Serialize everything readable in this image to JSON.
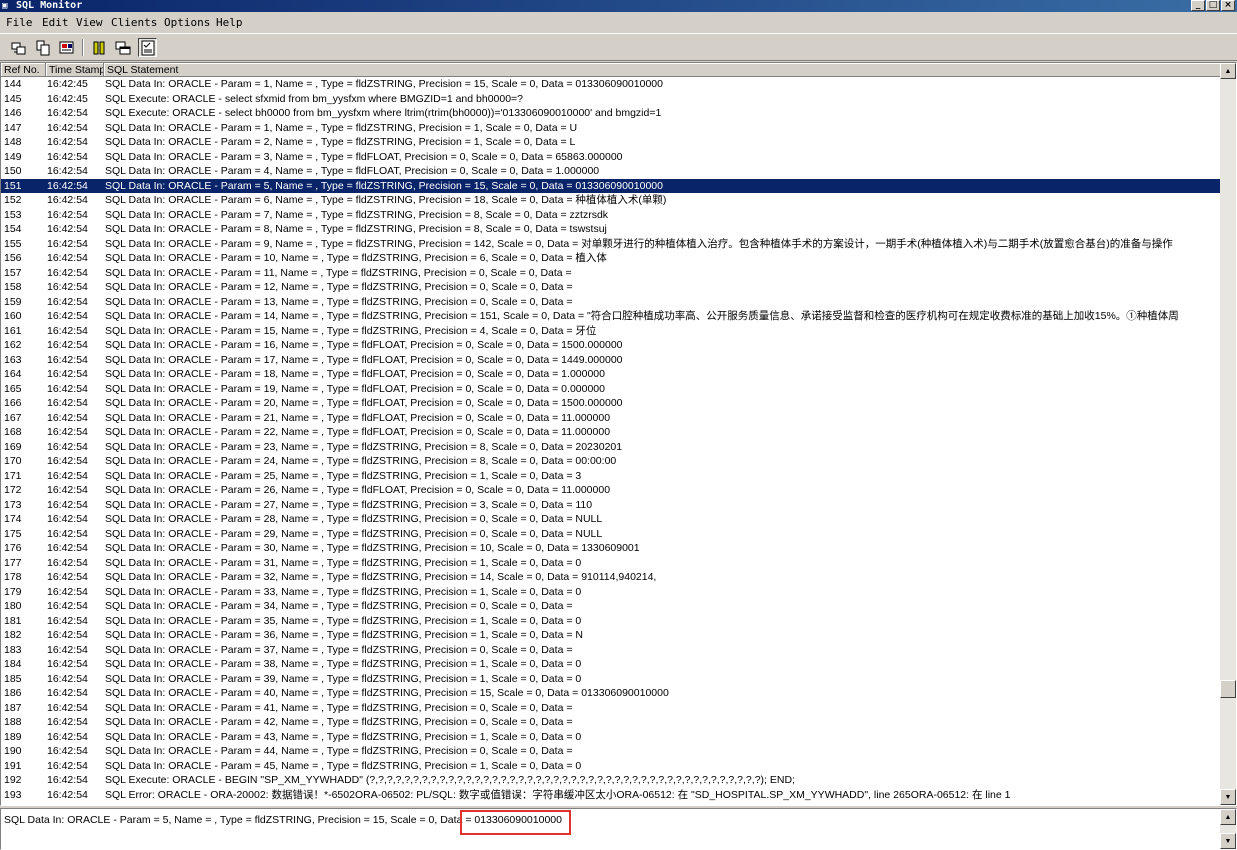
{
  "window": {
    "title": "SQL Monitor",
    "buttons": [
      "_",
      "□",
      "×"
    ]
  },
  "menu": [
    "File",
    "Edit",
    "View",
    "Clients",
    "Options",
    "Help"
  ],
  "toolbar": {
    "icons": [
      "clear-icon",
      "copy-icon",
      "print-icon",
      "pause-icon",
      "windows-icon",
      "checklist-icon"
    ]
  },
  "columns": [
    "Ref No.",
    "Time Stamp",
    "SQL Statement"
  ],
  "rows": [
    {
      "ref": "144",
      "time": "16:42:45",
      "sql": "SQL Data In: ORACLE - Param = 1, Name = , Type = fldZSTRING, Precision = 15, Scale = 0, Data = 013306090010000"
    },
    {
      "ref": "145",
      "time": "16:42:45",
      "sql": "SQL Execute: ORACLE - select sfxmid from bm_yysfxm where BMGZID=1 and bh0000=?"
    },
    {
      "ref": "146",
      "time": "16:42:54",
      "sql": "SQL Execute: ORACLE - select bh0000 from bm_yysfxm where ltrim(rtrim(bh0000))='013306090010000' and bmgzid=1"
    },
    {
      "ref": "147",
      "time": "16:42:54",
      "sql": "SQL Data In: ORACLE - Param = 1, Name = , Type = fldZSTRING, Precision = 1, Scale = 0, Data = U"
    },
    {
      "ref": "148",
      "time": "16:42:54",
      "sql": "SQL Data In: ORACLE - Param = 2, Name = , Type = fldZSTRING, Precision = 1, Scale = 0, Data = L"
    },
    {
      "ref": "149",
      "time": "16:42:54",
      "sql": "SQL Data In: ORACLE - Param = 3, Name = , Type = fldFLOAT, Precision = 0, Scale = 0, Data = 65863.000000"
    },
    {
      "ref": "150",
      "time": "16:42:54",
      "sql": "SQL Data In: ORACLE - Param = 4, Name = , Type = fldFLOAT, Precision = 0, Scale = 0, Data = 1.000000"
    },
    {
      "ref": "151",
      "time": "16:42:54",
      "sql": "SQL Data In: ORACLE - Param = 5, Name = , Type = fldZSTRING, Precision = 15, Scale = 0, Data = 013306090010000",
      "selected": true
    },
    {
      "ref": "152",
      "time": "16:42:54",
      "sql": "SQL Data In: ORACLE - Param = 6, Name = , Type = fldZSTRING, Precision = 18, Scale = 0, Data = 种植体植入术(单颗)"
    },
    {
      "ref": "153",
      "time": "16:42:54",
      "sql": "SQL Data In: ORACLE - Param = 7, Name = , Type = fldZSTRING, Precision = 8, Scale = 0, Data = zztzrsdk"
    },
    {
      "ref": "154",
      "time": "16:42:54",
      "sql": "SQL Data In: ORACLE - Param = 8, Name = , Type = fldZSTRING, Precision = 8, Scale = 0, Data = tswstsuj"
    },
    {
      "ref": "155",
      "time": "16:42:54",
      "sql": "SQL Data In: ORACLE - Param = 9, Name = , Type = fldZSTRING, Precision = 142, Scale = 0, Data = 对单颗牙进行的种植体植入治疗。包含种植体手术的方案设计，一期手术(种植体植入术)与二期手术(放置愈合基台)的准备与操作"
    },
    {
      "ref": "156",
      "time": "16:42:54",
      "sql": "SQL Data In: ORACLE - Param = 10, Name = , Type = fldZSTRING, Precision = 6, Scale = 0, Data = 植入体"
    },
    {
      "ref": "157",
      "time": "16:42:54",
      "sql": "SQL Data In: ORACLE - Param = 11, Name = , Type = fldZSTRING, Precision = 0, Scale = 0, Data ="
    },
    {
      "ref": "158",
      "time": "16:42:54",
      "sql": "SQL Data In: ORACLE - Param = 12, Name = , Type = fldZSTRING, Precision = 0, Scale = 0, Data ="
    },
    {
      "ref": "159",
      "time": "16:42:54",
      "sql": "SQL Data In: ORACLE - Param = 13, Name = , Type = fldZSTRING, Precision = 0, Scale = 0, Data ="
    },
    {
      "ref": "160",
      "time": "16:42:54",
      "sql": "SQL Data In: ORACLE - Param = 14, Name = , Type = fldZSTRING, Precision = 151, Scale = 0, Data = \"符合口腔种植成功率高、公开服务质量信息、承诺接受监督和检查的医疗机构可在规定收费标准的基础上加收15%。①种植体周"
    },
    {
      "ref": "161",
      "time": "16:42:54",
      "sql": "SQL Data In: ORACLE - Param = 15, Name = , Type = fldZSTRING, Precision = 4, Scale = 0, Data = 牙位"
    },
    {
      "ref": "162",
      "time": "16:42:54",
      "sql": "SQL Data In: ORACLE - Param = 16, Name = , Type = fldFLOAT, Precision = 0, Scale = 0, Data = 1500.000000"
    },
    {
      "ref": "163",
      "time": "16:42:54",
      "sql": "SQL Data In: ORACLE - Param = 17, Name = , Type = fldFLOAT, Precision = 0, Scale = 0, Data = 1449.000000"
    },
    {
      "ref": "164",
      "time": "16:42:54",
      "sql": "SQL Data In: ORACLE - Param = 18, Name = , Type = fldFLOAT, Precision = 0, Scale = 0, Data = 1.000000"
    },
    {
      "ref": "165",
      "time": "16:42:54",
      "sql": "SQL Data In: ORACLE - Param = 19, Name = , Type = fldFLOAT, Precision = 0, Scale = 0, Data = 0.000000"
    },
    {
      "ref": "166",
      "time": "16:42:54",
      "sql": "SQL Data In: ORACLE - Param = 20, Name = , Type = fldFLOAT, Precision = 0, Scale = 0, Data = 1500.000000"
    },
    {
      "ref": "167",
      "time": "16:42:54",
      "sql": "SQL Data In: ORACLE - Param = 21, Name = , Type = fldFLOAT, Precision = 0, Scale = 0, Data = 11.000000"
    },
    {
      "ref": "168",
      "time": "16:42:54",
      "sql": "SQL Data In: ORACLE - Param = 22, Name = , Type = fldFLOAT, Precision = 0, Scale = 0, Data = 11.000000"
    },
    {
      "ref": "169",
      "time": "16:42:54",
      "sql": "SQL Data In: ORACLE - Param = 23, Name = , Type = fldZSTRING, Precision = 8, Scale = 0, Data = 20230201"
    },
    {
      "ref": "170",
      "time": "16:42:54",
      "sql": "SQL Data In: ORACLE - Param = 24, Name = , Type = fldZSTRING, Precision = 8, Scale = 0, Data = 00:00:00"
    },
    {
      "ref": "171",
      "time": "16:42:54",
      "sql": "SQL Data In: ORACLE - Param = 25, Name = , Type = fldZSTRING, Precision = 1, Scale = 0, Data = 3"
    },
    {
      "ref": "172",
      "time": "16:42:54",
      "sql": "SQL Data In: ORACLE - Param = 26, Name = , Type = fldFLOAT, Precision = 0, Scale = 0, Data = 11.000000"
    },
    {
      "ref": "173",
      "time": "16:42:54",
      "sql": "SQL Data In: ORACLE - Param = 27, Name = , Type = fldZSTRING, Precision = 3, Scale = 0, Data = 110"
    },
    {
      "ref": "174",
      "time": "16:42:54",
      "sql": "SQL Data In: ORACLE - Param = 28, Name = , Type = fldZSTRING, Precision = 0, Scale = 0, Data = NULL"
    },
    {
      "ref": "175",
      "time": "16:42:54",
      "sql": "SQL Data In: ORACLE - Param = 29, Name = , Type = fldZSTRING, Precision = 0, Scale = 0, Data = NULL"
    },
    {
      "ref": "176",
      "time": "16:42:54",
      "sql": "SQL Data In: ORACLE - Param = 30, Name = , Type = fldZSTRING, Precision = 10, Scale = 0, Data = 1330609001"
    },
    {
      "ref": "177",
      "time": "16:42:54",
      "sql": "SQL Data In: ORACLE - Param = 31, Name = , Type = fldZSTRING, Precision = 1, Scale = 0, Data = 0"
    },
    {
      "ref": "178",
      "time": "16:42:54",
      "sql": "SQL Data In: ORACLE - Param = 32, Name = , Type = fldZSTRING, Precision = 14, Scale = 0, Data = 910114,940214,"
    },
    {
      "ref": "179",
      "time": "16:42:54",
      "sql": "SQL Data In: ORACLE - Param = 33, Name = , Type = fldZSTRING, Precision = 1, Scale = 0, Data = 0"
    },
    {
      "ref": "180",
      "time": "16:42:54",
      "sql": "SQL Data In: ORACLE - Param = 34, Name = , Type = fldZSTRING, Precision = 0, Scale = 0, Data ="
    },
    {
      "ref": "181",
      "time": "16:42:54",
      "sql": "SQL Data In: ORACLE - Param = 35, Name = , Type = fldZSTRING, Precision = 1, Scale = 0, Data = 0"
    },
    {
      "ref": "182",
      "time": "16:42:54",
      "sql": "SQL Data In: ORACLE - Param = 36, Name = , Type = fldZSTRING, Precision = 1, Scale = 0, Data = N"
    },
    {
      "ref": "183",
      "time": "16:42:54",
      "sql": "SQL Data In: ORACLE - Param = 37, Name = , Type = fldZSTRING, Precision = 0, Scale = 0, Data ="
    },
    {
      "ref": "184",
      "time": "16:42:54",
      "sql": "SQL Data In: ORACLE - Param = 38, Name = , Type = fldZSTRING, Precision = 1, Scale = 0, Data = 0"
    },
    {
      "ref": "185",
      "time": "16:42:54",
      "sql": "SQL Data In: ORACLE - Param = 39, Name = , Type = fldZSTRING, Precision = 1, Scale = 0, Data = 0"
    },
    {
      "ref": "186",
      "time": "16:42:54",
      "sql": "SQL Data In: ORACLE - Param = 40, Name = , Type = fldZSTRING, Precision = 15, Scale = 0, Data = 013306090010000"
    },
    {
      "ref": "187",
      "time": "16:42:54",
      "sql": "SQL Data In: ORACLE - Param = 41, Name = , Type = fldZSTRING, Precision = 0, Scale = 0, Data ="
    },
    {
      "ref": "188",
      "time": "16:42:54",
      "sql": "SQL Data In: ORACLE - Param = 42, Name = , Type = fldZSTRING, Precision = 0, Scale = 0, Data ="
    },
    {
      "ref": "189",
      "time": "16:42:54",
      "sql": "SQL Data In: ORACLE - Param = 43, Name = , Type = fldZSTRING, Precision = 1, Scale = 0, Data = 0"
    },
    {
      "ref": "190",
      "time": "16:42:54",
      "sql": "SQL Data In: ORACLE - Param = 44, Name = , Type = fldZSTRING, Precision = 0, Scale = 0, Data ="
    },
    {
      "ref": "191",
      "time": "16:42:54",
      "sql": "SQL Data In: ORACLE - Param = 45, Name = , Type = fldZSTRING, Precision = 1, Scale = 0, Data = 0"
    },
    {
      "ref": "192",
      "time": "16:42:54",
      "sql": "SQL Execute: ORACLE - BEGIN \"SP_XM_YYWHADD\" (?,?,?,?,?,?,?,?,?,?,?,?,?,?,?,?,?,?,?,?,?,?,?,?,?,?,?,?,?,?,?,?,?,?,?,?,?,?,?,?,?,?,?,?,?); END;"
    },
    {
      "ref": "193",
      "time": "16:42:54",
      "sql": "SQL Error: ORACLE - ORA-20002: 数据错误！*-6502ORA-06502: PL/SQL: 数字或值错误：字符串缓冲区太小ORA-06512: 在 \"SD_HOSPITAL.SP_XM_YYWHADD\", line 265ORA-06512: 在 line 1"
    }
  ],
  "detail": {
    "text": "SQL Data In: ORACLE - Param = 5, Name = , Type = fldZSTRING, Precision = 15, Scale = 0, Data = 013306090010000"
  },
  "colors": {
    "selection": "#0a246a",
    "annotation": "#e0332e"
  }
}
